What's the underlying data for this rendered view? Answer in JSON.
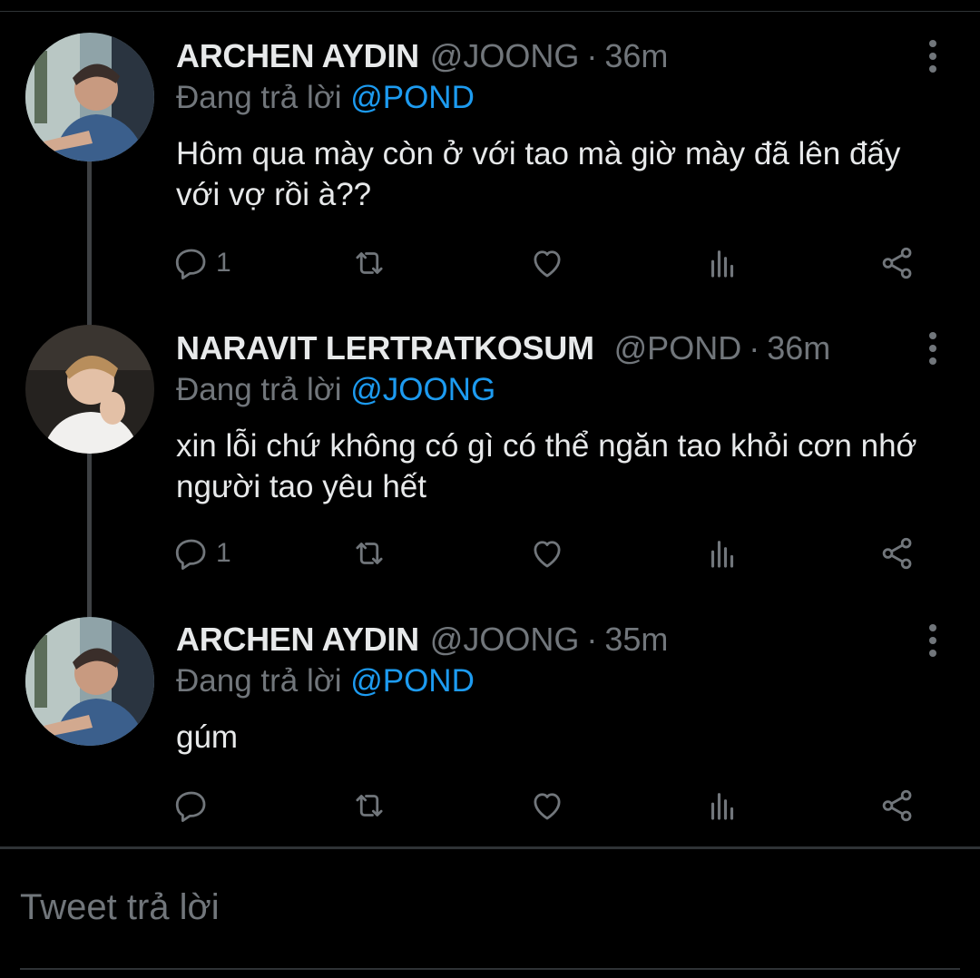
{
  "tweets": [
    {
      "name": "ARCHEN AYDIN",
      "handle": "@JOONG",
      "separator": "·",
      "time": "36m",
      "reply_prefix": "Đang trả lời",
      "reply_mention": "@POND",
      "text": "Hôm qua mày còn ở với tao mà giờ mày đã lên đấy với vợ rồi à??",
      "reply_count": "1"
    },
    {
      "name": "NARAVIT LERTRATKOSUM",
      "handle": "@POND",
      "separator": "·",
      "time": "36m",
      "reply_prefix": "Đang trả lời",
      "reply_mention": "@JOONG",
      "text": "xin lỗi chứ không có gì có thể ngăn tao khỏi cơn nhớ người tao yêu hết",
      "reply_count": "1"
    },
    {
      "name": "ARCHEN AYDIN",
      "handle": "@JOONG",
      "separator": "·",
      "time": "35m",
      "reply_prefix": "Đang trả lời",
      "reply_mention": "@POND",
      "text": "gúm",
      "reply_count": ""
    }
  ],
  "composer": {
    "placeholder": "Tweet trả lời"
  },
  "icons": {
    "reply": "reply-icon",
    "retweet": "retweet-icon",
    "like": "like-icon",
    "views": "views-icon",
    "share": "share-icon",
    "more": "more-icon"
  },
  "colors": {
    "background": "#000000",
    "text": "#e7e9ea",
    "muted": "#71767b",
    "mention": "#1d9bf0",
    "divider": "#2f3336"
  }
}
